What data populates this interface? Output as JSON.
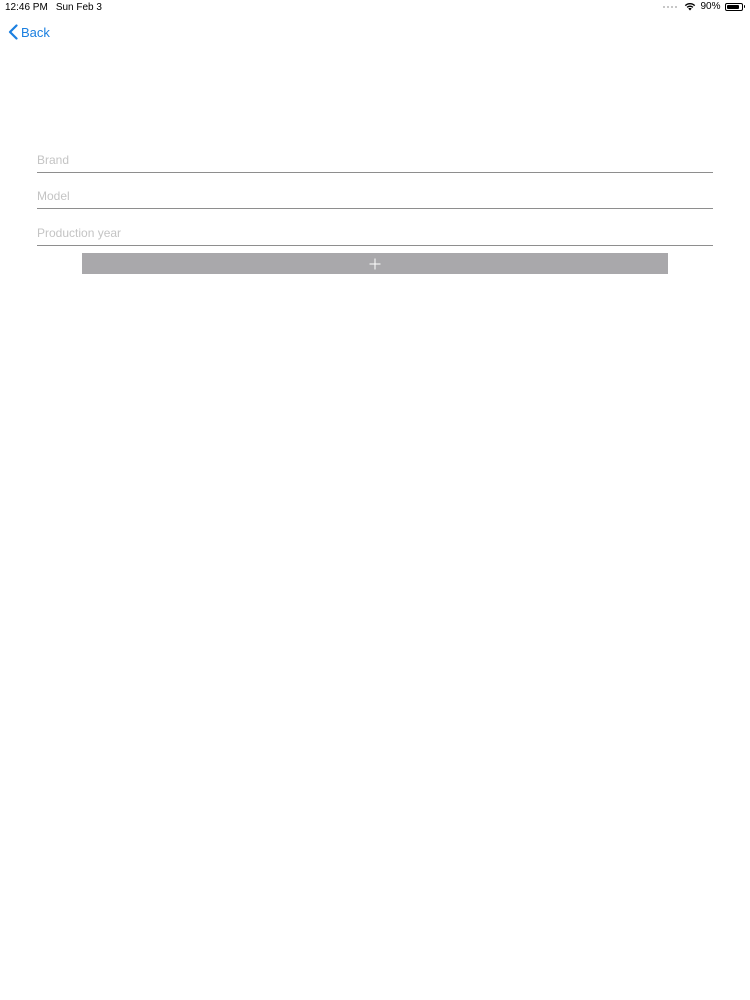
{
  "status_bar": {
    "time": "12:46 PM",
    "date": "Sun Feb 3",
    "battery": "90%",
    "battery_level": 0.9,
    "icons": [
      "cellular-signal-icon",
      "wifi-icon",
      "battery-icon"
    ]
  },
  "nav": {
    "back_label": "Back",
    "back_icon": "chevron-left-icon"
  },
  "form": {
    "brand_placeholder": "Brand",
    "brand_value": "",
    "model_placeholder": "Model",
    "model_value": "",
    "year_placeholder": "Production year",
    "year_value": "",
    "add_icon": "plus-icon"
  },
  "colors": {
    "accent": "#1a7fe0",
    "button_bg": "#a9a8ab",
    "underline": "#8e8e8e",
    "placeholder": "#c4c4c4"
  }
}
